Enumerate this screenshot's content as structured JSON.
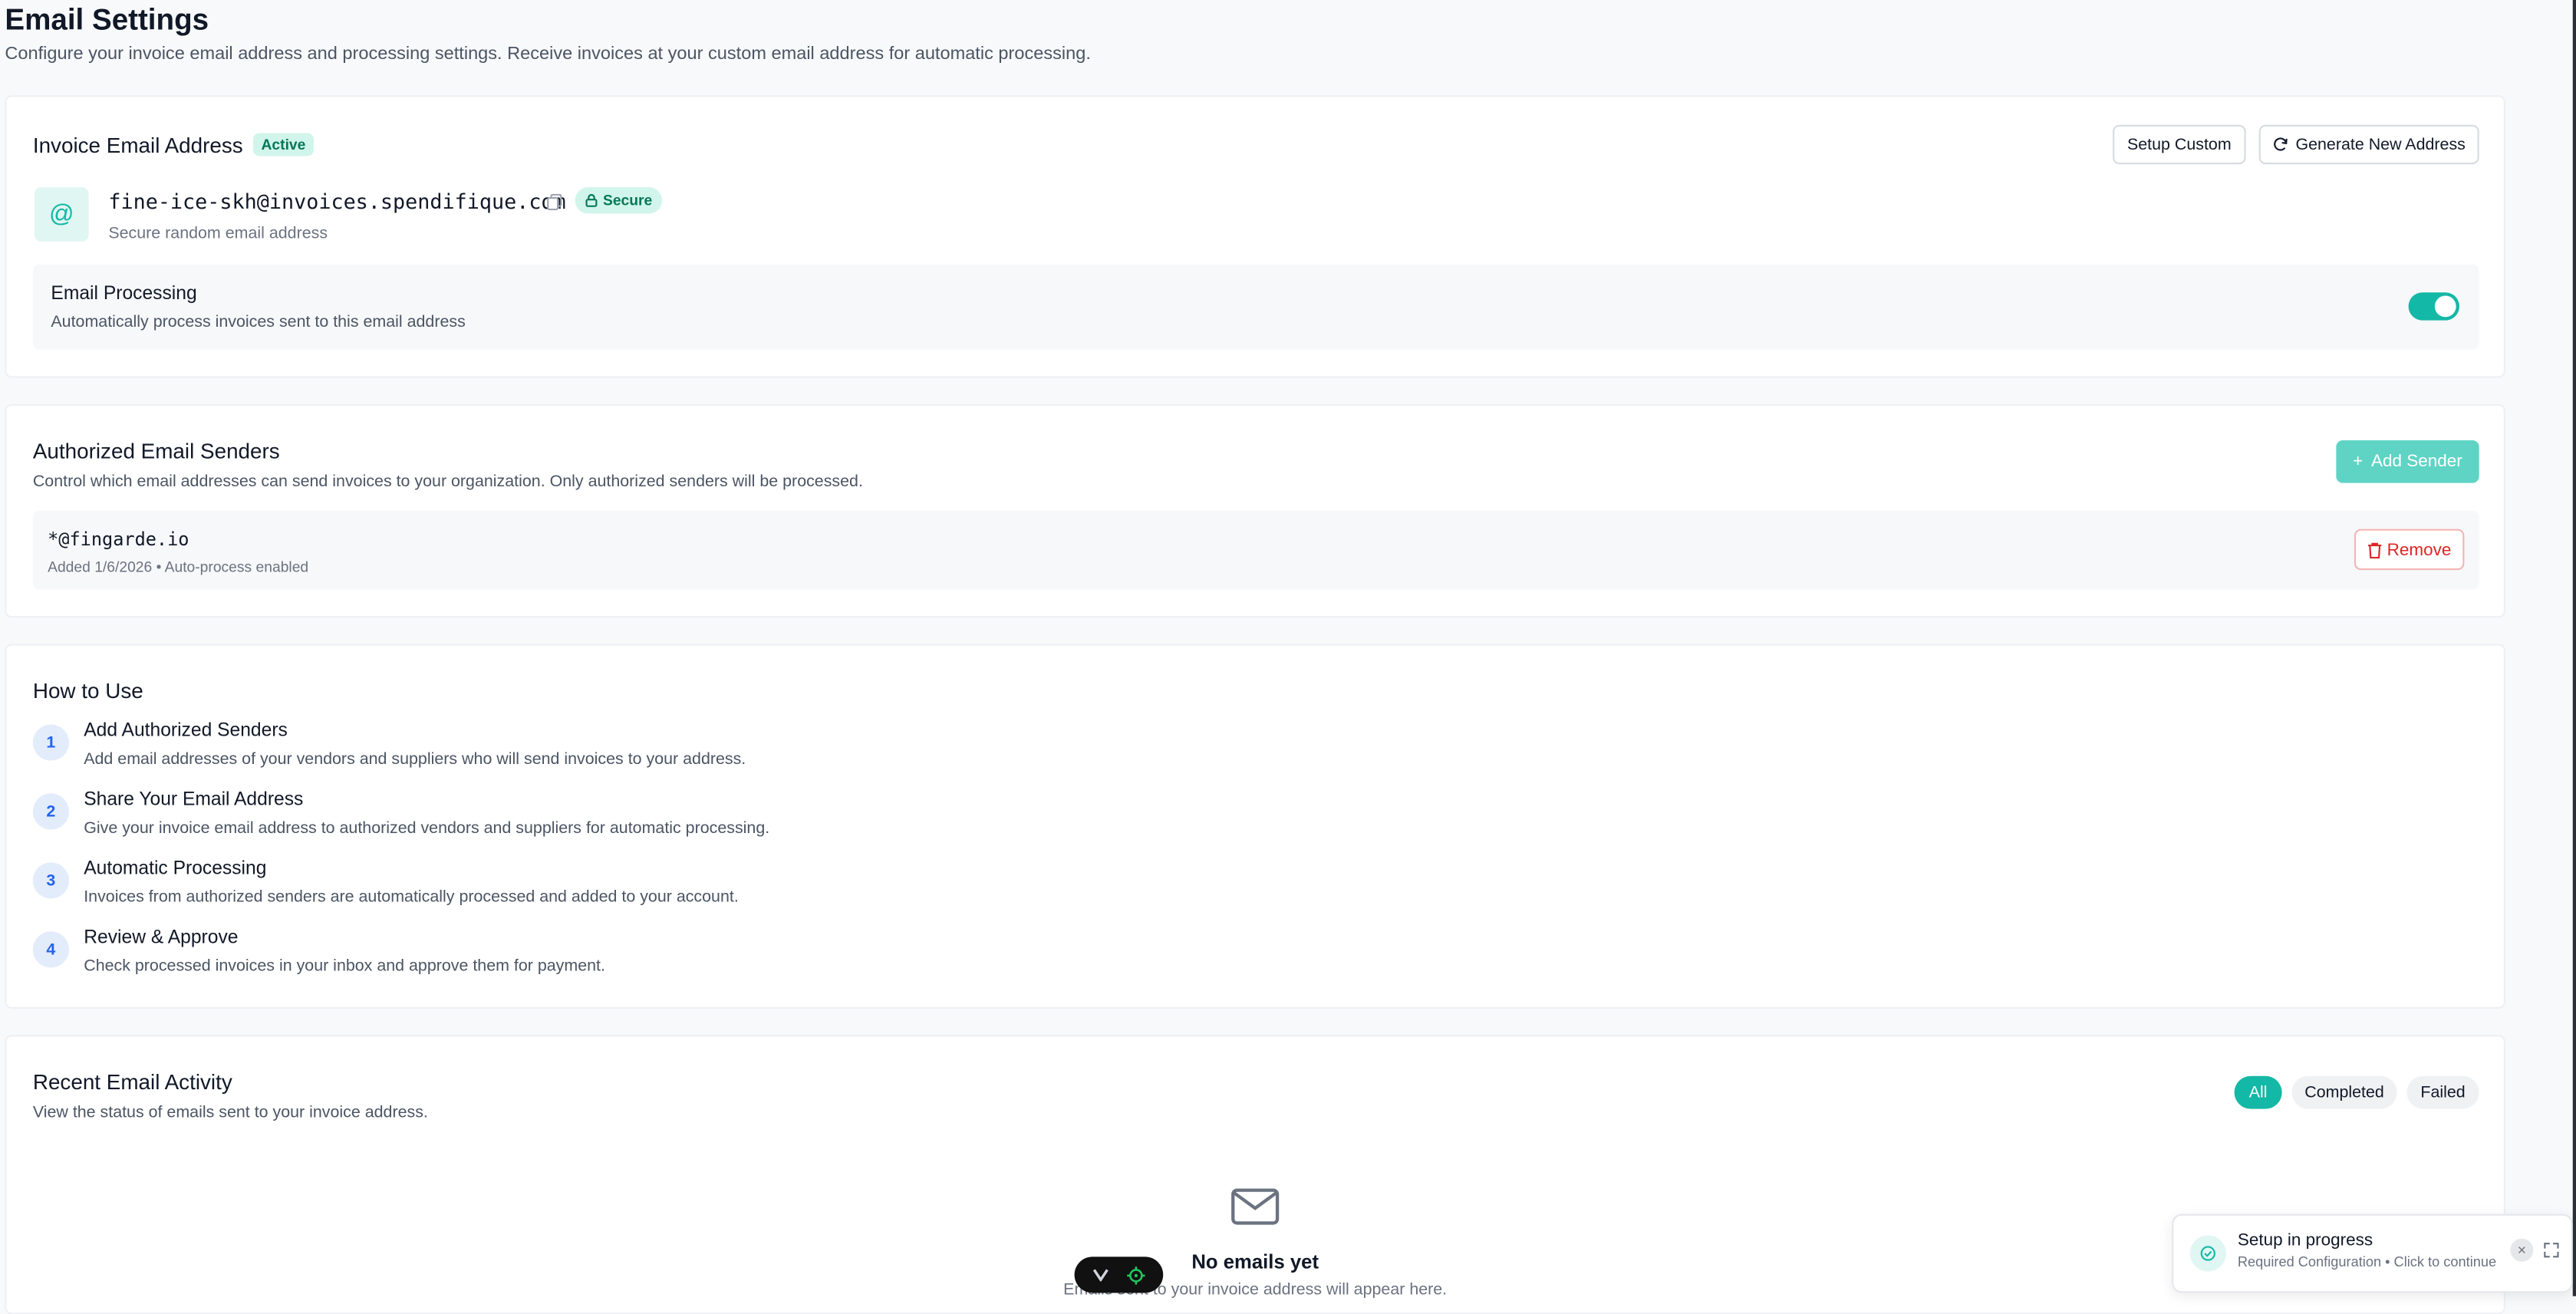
{
  "header": {
    "title": "Email Settings",
    "subtitle": "Configure your invoice email address and processing settings. Receive invoices at your custom email address for automatic processing."
  },
  "invoice_email": {
    "title": "Invoice Email Address",
    "status_badge": "Active",
    "setup_custom_label": "Setup Custom",
    "generate_label": "Generate New Address",
    "address": "fine-ice-skh@invoices.spendifique.com",
    "secure_badge": "Secure",
    "address_note": "Secure random email address",
    "processing_title": "Email Processing",
    "processing_desc": "Automatically process invoices sent to this email address",
    "processing_enabled": true
  },
  "senders": {
    "title": "Authorized Email Senders",
    "description": "Control which email addresses can send invoices to your organization. Only authorized senders will be processed.",
    "add_label": "Add Sender",
    "items": [
      {
        "address": "*@fingarde.io",
        "meta": "Added 1/6/2026 • Auto-process enabled",
        "remove_label": "Remove"
      }
    ]
  },
  "how_to": {
    "title": "How to Use",
    "steps": [
      {
        "num": "1",
        "title": "Add Authorized Senders",
        "desc": "Add email addresses of your vendors and suppliers who will send invoices to your address."
      },
      {
        "num": "2",
        "title": "Share Your Email Address",
        "desc": "Give your invoice email address to authorized vendors and suppliers for automatic processing."
      },
      {
        "num": "3",
        "title": "Automatic Processing",
        "desc": "Invoices from authorized senders are automatically processed and added to your account."
      },
      {
        "num": "4",
        "title": "Review & Approve",
        "desc": "Check processed invoices in your inbox and approve them for payment."
      }
    ]
  },
  "activity": {
    "title": "Recent Email Activity",
    "description": "View the status of emails sent to your invoice address.",
    "filters": [
      "All",
      "Completed",
      "Failed"
    ],
    "active_filter": "All",
    "empty_title": "No emails yet",
    "empty_desc": "Emails sent to your invoice address will appear here."
  },
  "toast": {
    "title": "Setup in progress",
    "subtitle": "Required Configuration • Click to continue"
  },
  "colors": {
    "accent": "#14b8a6",
    "danger": "#dc2626",
    "badge_green": "#047857"
  }
}
